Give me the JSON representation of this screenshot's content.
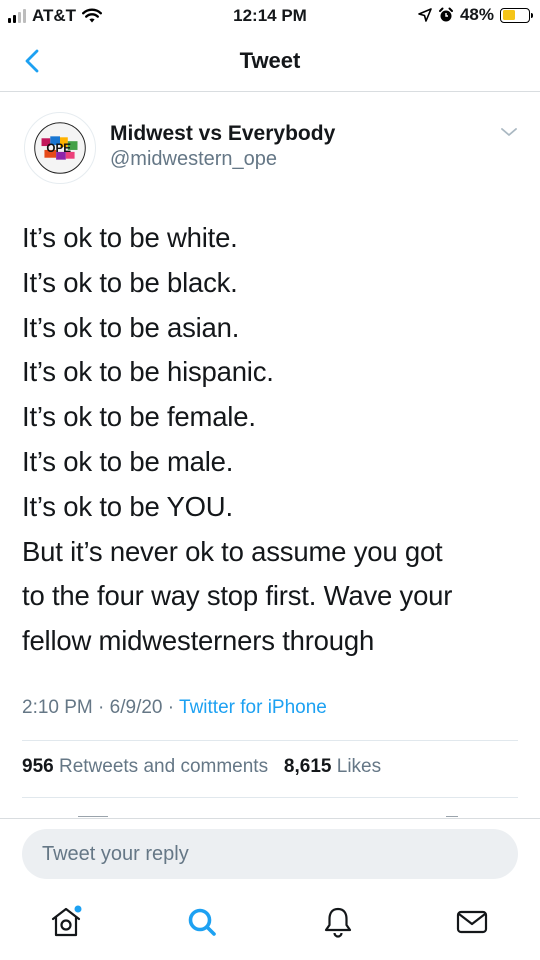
{
  "status_bar": {
    "carrier": "AT&T",
    "time": "12:14 PM",
    "battery": "48%",
    "battery_level": 0.48,
    "icons": [
      "signal-icon",
      "wifi-icon",
      "location-icon",
      "alarm-icon",
      "battery-icon"
    ]
  },
  "nav": {
    "title": "Tweet",
    "back_icon": "chevron-left-icon"
  },
  "tweet": {
    "author_name": "Midwest vs Everybody",
    "handle": "@midwestern_ope",
    "avatar_text": "OPE",
    "lines": [
      "It’s ok to be white.",
      "It’s ok to be black.",
      "It’s ok to be asian.",
      "It’s ok to be hispanic.",
      "It’s ok to be female.",
      "It’s ok to be male.",
      "It’s ok to be YOU.",
      "But it’s never ok to assume you got",
      "to the four way stop first. Wave your",
      "fellow midwesterners through"
    ],
    "time": "2:10 PM",
    "date": "6/9/20",
    "source": "Twitter for iPhone",
    "retweets_count": "956",
    "retweets_label": "Retweets and comments",
    "likes_count": "8,615",
    "likes_label": "Likes"
  },
  "reply": {
    "placeholder": "Tweet your reply"
  },
  "tab_bar": {
    "items": [
      "home-icon",
      "search-icon",
      "notifications-icon",
      "messages-icon"
    ],
    "accent_color": "#1da1f2"
  },
  "colors": {
    "accent": "#1da1f2",
    "secondary_text": "#657786",
    "text": "#14171a"
  }
}
